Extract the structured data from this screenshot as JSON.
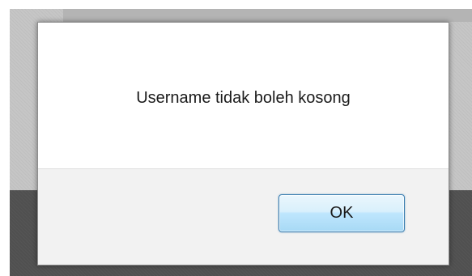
{
  "dialog": {
    "message": "Username tidak boleh kosong",
    "ok_label": "OK"
  },
  "colors": {
    "dialog_body": "#ffffff",
    "dialog_footer": "#f2f2f2",
    "button_border": "#3c7fb1",
    "backdrop_light": "#c6c6c6",
    "backdrop_dark": "#505050"
  }
}
